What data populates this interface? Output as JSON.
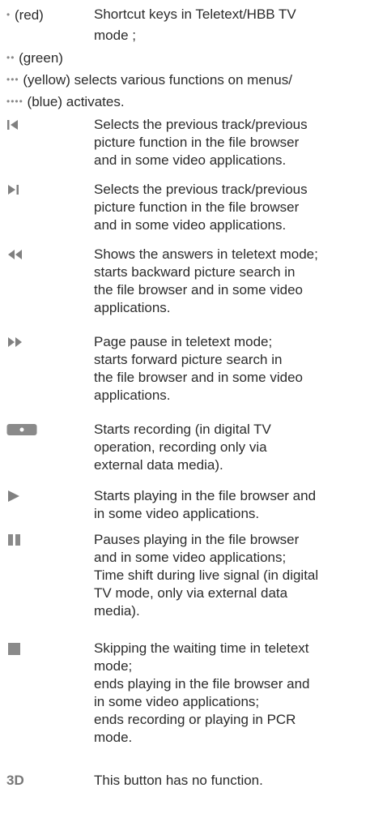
{
  "colour_keys": {
    "red": {
      "dots": "•",
      "label": "(red)",
      "desc_1": "Shortcut keys in Teletext/HBB TV",
      "desc_2": "mode ;"
    },
    "green": {
      "dots": "••",
      "label": "(green)"
    },
    "yellow": {
      "dots": "•••",
      "label": "(yellow) selects various functions on menus/"
    },
    "blue": {
      "dots": "••••",
      "label": "(blue) activates."
    }
  },
  "entries": [
    {
      "icon": "skip-previous-icon",
      "lines": [
        "Selects the previous track/previous",
        "picture function in the file browser",
        "and in some video applications."
      ]
    },
    {
      "icon": "skip-next-icon",
      "lines": [
        "Selects the previous track/previous",
        "picture function in the file browser",
        "and in some video applications."
      ]
    },
    {
      "icon": "rewind-icon",
      "lines": [
        "Shows the answers in teletext mode;",
        "starts backward picture search in",
        "the file browser and in some video",
        "applications."
      ]
    },
    {
      "icon": "fast-forward-icon",
      "lines": [
        "Page pause in teletext mode;",
        "starts forward picture search in",
        "the file browser and in some video",
        "applications."
      ]
    },
    {
      "icon": "record-icon",
      "lines": [
        "Starts recording (in digital TV",
        "operation, recording only via",
        "external data media)."
      ]
    },
    {
      "icon": "play-icon",
      "lines": [
        "Starts playing in the file browser and",
        "in some video applications."
      ]
    },
    {
      "icon": "pause-icon",
      "lines": [
        "Pauses playing in the file browser",
        "and in some video applications;",
        "Time shift during live signal (in digital",
        "TV mode, only via external data",
        "media)."
      ]
    },
    {
      "icon": "stop-icon",
      "lines": [
        "Skipping the waiting time in teletext",
        "mode;",
        "ends playing in the file browser and",
        "in some video applications;",
        "ends recording or playing in PCR",
        "mode."
      ]
    },
    {
      "icon": "3d-key",
      "key_text": "3D",
      "lines": [
        "This button has no function."
      ]
    }
  ]
}
